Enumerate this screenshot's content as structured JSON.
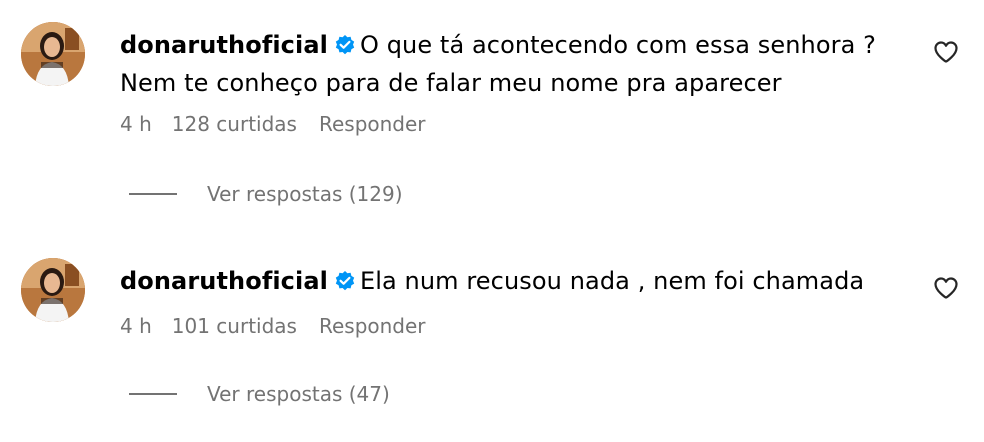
{
  "comments": [
    {
      "username": "donaruthoficial",
      "text": "O que tá acontecendo com essa senhora ? Nem te conheço para de falar meu nome pra aparecer",
      "time": "4 h",
      "likes": "128 curtidas",
      "reply_label": "Responder",
      "view_replies": "Ver respostas (129)"
    },
    {
      "username": "donaruthoficial",
      "text": "Ela num recusou nada , nem foi chamada",
      "time": "4 h",
      "likes": "101 curtidas",
      "reply_label": "Responder",
      "view_replies": "Ver respostas (47)"
    }
  ],
  "icons": {
    "verified": "verified-badge-icon",
    "like": "heart-outline-icon"
  },
  "colors": {
    "verified_blue": "#0095f6",
    "meta_gray": "#737373",
    "text": "#000000"
  }
}
